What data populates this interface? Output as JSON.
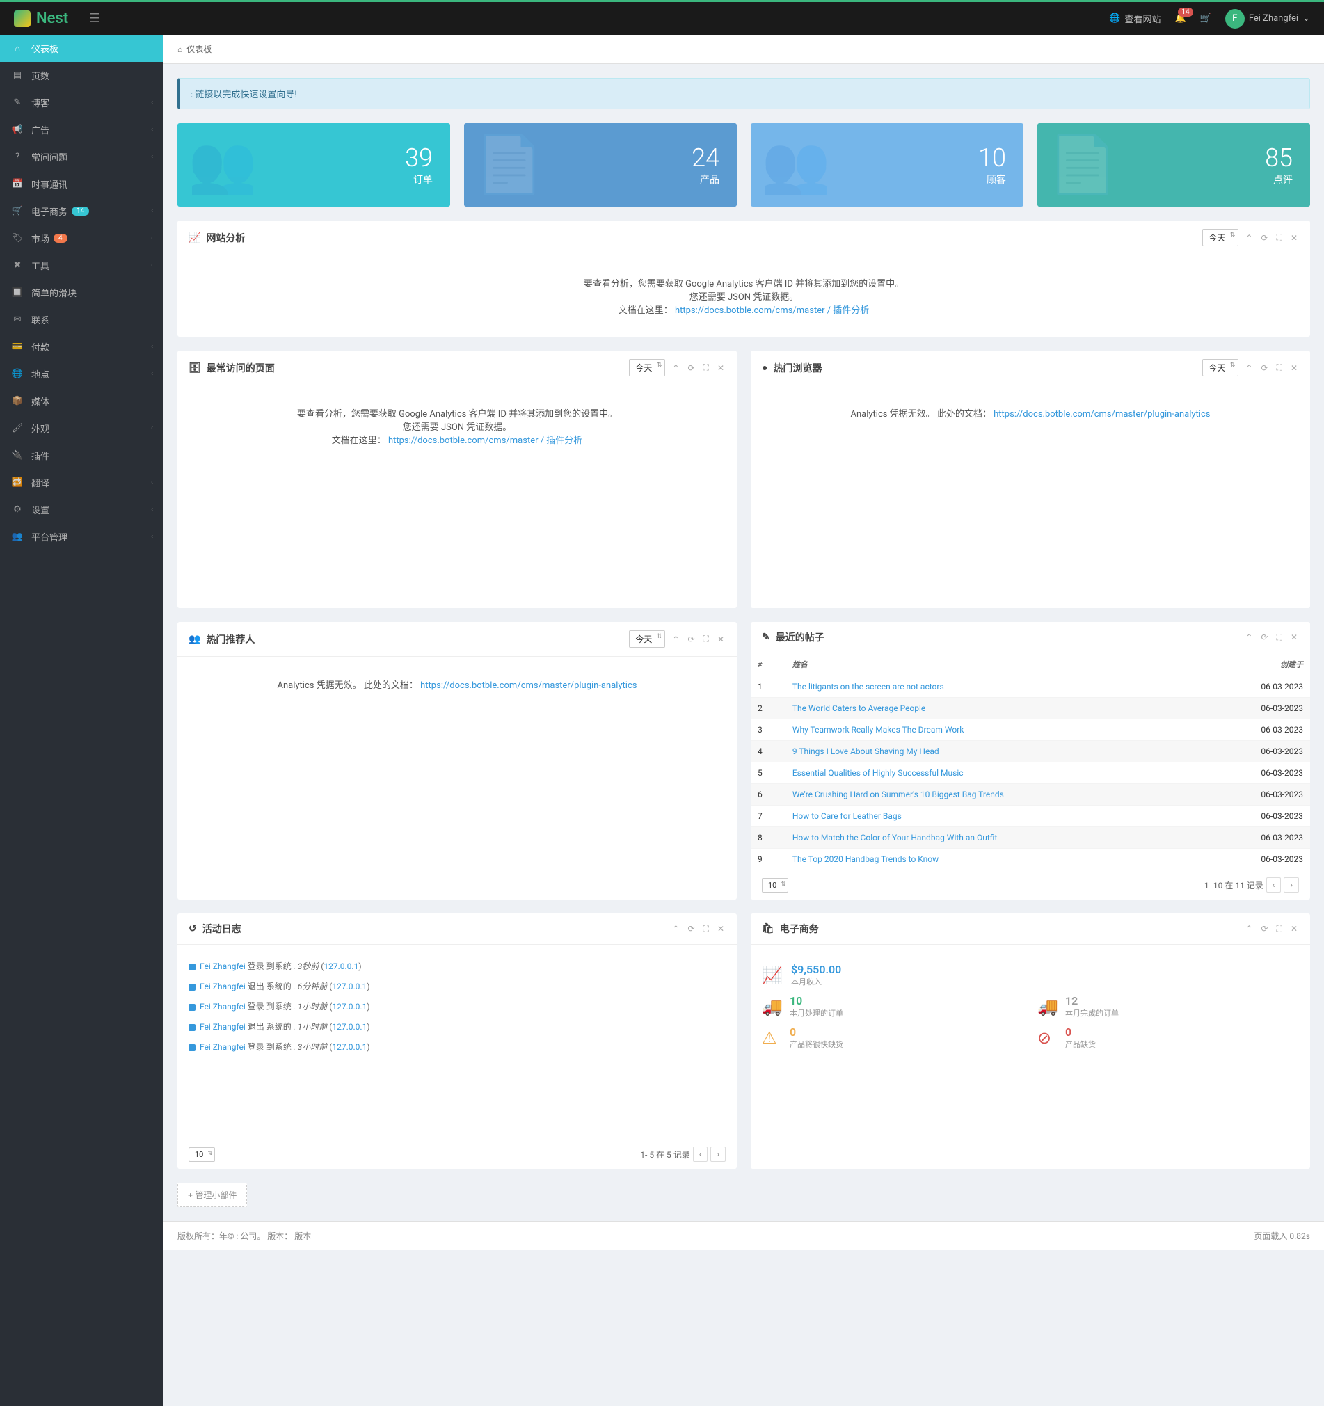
{
  "brand": "Nest",
  "navbar": {
    "view_site": "查看网站",
    "notif_count": "14",
    "user_initial": "F",
    "user_name": "Fei Zhangfei"
  },
  "sidebar": {
    "items": [
      {
        "icon": "⌂",
        "label": "仪表板",
        "active": true
      },
      {
        "icon": "▤",
        "label": "页数"
      },
      {
        "icon": "✎",
        "label": "博客",
        "chevron": true
      },
      {
        "icon": "📢",
        "label": "广告",
        "chevron": true
      },
      {
        "icon": "?",
        "label": "常问问题",
        "chevron": true
      },
      {
        "icon": "📅",
        "label": "时事通讯"
      },
      {
        "icon": "🛒",
        "label": "电子商务",
        "badge": "14",
        "chevron": true
      },
      {
        "icon": "🏷",
        "label": "市场",
        "badge": "4",
        "badge_class": "orange",
        "chevron": true
      },
      {
        "icon": "✖",
        "label": "工具",
        "chevron": true
      },
      {
        "icon": "🔲",
        "label": "简单的滑块"
      },
      {
        "icon": "✉",
        "label": "联系"
      },
      {
        "icon": "💳",
        "label": "付款",
        "chevron": true
      },
      {
        "icon": "🌐",
        "label": "地点",
        "chevron": true
      },
      {
        "icon": "📦",
        "label": "媒体"
      },
      {
        "icon": "🖌",
        "label": "外观",
        "chevron": true
      },
      {
        "icon": "🔌",
        "label": "插件"
      },
      {
        "icon": "🔁",
        "label": "翻译",
        "chevron": true
      },
      {
        "icon": "⚙",
        "label": "设置",
        "chevron": true
      },
      {
        "icon": "👥",
        "label": "平台管理",
        "chevron": true
      }
    ]
  },
  "breadcrumb": "仪表板",
  "alert_text": "链接以完成快速设置向导!",
  "tiles": [
    {
      "value": "39",
      "label": "订单",
      "icon": "👥"
    },
    {
      "value": "24",
      "label": "产品",
      "icon": "📄"
    },
    {
      "value": "10",
      "label": "顾客",
      "icon": "👥"
    },
    {
      "value": "85",
      "label": "点评",
      "icon": "📄"
    }
  ],
  "period_options": "今天",
  "panels": {
    "analytics": {
      "title": "网站分析",
      "msg1": "要查看分析，您需要获取 Google Analytics 客户端 ID 并将其添加到您的设置中。",
      "msg2": "您还需要 JSON 凭证数据。",
      "msg3_prefix": "文档在这里：",
      "msg3_link": "https://docs.botble.com/cms/master / 插件分析"
    },
    "top_pages": {
      "title": "最常访问的页面",
      "msg1": "要查看分析，您需要获取 Google Analytics 客户端 ID 并将其添加到您的设置中。",
      "msg2": "您还需要 JSON 凭证数据。",
      "msg3_prefix": "文档在这里：",
      "msg3_link": "https://docs.botble.com/cms/master / 插件分析"
    },
    "top_browsers": {
      "title": "热门浏览器",
      "msg_prefix": "Analytics 凭据无效。 此处的文档：",
      "msg_link": "https://docs.botble.com/cms/master/plugin-analytics"
    },
    "top_referrers": {
      "title": "热门推荐人",
      "msg_prefix": "Analytics 凭据无效。 此处的文档：",
      "msg_link": "https://docs.botble.com/cms/master/plugin-analytics"
    },
    "recent_posts": {
      "title": "最近的帖子",
      "cols": {
        "num": "#",
        "name": "姓名",
        "created": "创建于"
      },
      "rows": [
        {
          "n": "1",
          "title": "The litigants on the screen are not actors",
          "date": "06-03-2023"
        },
        {
          "n": "2",
          "title": "The World Caters to Average People",
          "date": "06-03-2023"
        },
        {
          "n": "3",
          "title": "Why Teamwork Really Makes The Dream Work",
          "date": "06-03-2023"
        },
        {
          "n": "4",
          "title": "9 Things I Love About Shaving My Head",
          "date": "06-03-2023"
        },
        {
          "n": "5",
          "title": "Essential Qualities of Highly Successful Music",
          "date": "06-03-2023"
        },
        {
          "n": "6",
          "title": "We're Crushing Hard on Summer's 10 Biggest Bag Trends",
          "date": "06-03-2023"
        },
        {
          "n": "7",
          "title": "How to Care for Leather Bags",
          "date": "06-03-2023"
        },
        {
          "n": "8",
          "title": "How to Match the Color of Your Handbag With an Outfit",
          "date": "06-03-2023"
        },
        {
          "n": "9",
          "title": "The Top 2020 Handbag Trends to Know",
          "date": "06-03-2023"
        }
      ],
      "page_size": "10",
      "pager_text": "1- 10 在 11 记录"
    },
    "activity": {
      "title": "活动日志",
      "items": [
        {
          "user": "Fei Zhangfei",
          "action": "登录  到系统",
          "time": ". 3秒前",
          "ip": "127.0.0.1"
        },
        {
          "user": "Fei Zhangfei",
          "action": "退出 系统的",
          "time": ". 6分钟前",
          "ip": "127.0.0.1"
        },
        {
          "user": "Fei Zhangfei",
          "action": "登录  到系统",
          "time": ". 1小时前",
          "ip": "127.0.0.1"
        },
        {
          "user": "Fei Zhangfei",
          "action": "退出 系统的",
          "time": ". 1小时前",
          "ip": "127.0.0.1"
        },
        {
          "user": "Fei Zhangfei",
          "action": "登录  到系统",
          "time": ". 3小时前",
          "ip": "127.0.0.1"
        }
      ],
      "page_size": "10",
      "pager_text": "1- 5 在 5 记录"
    },
    "ecommerce": {
      "title": "电子商务",
      "revenue": "$9,550.00",
      "revenue_label": "本月收入",
      "stats": [
        {
          "icon": "🚚",
          "color": "#3BB77E",
          "val": "10",
          "label": "本月处理的订单"
        },
        {
          "icon": "🚚",
          "color": "#999",
          "val": "12",
          "label": "本月完成的订单"
        },
        {
          "icon": "⚠",
          "color": "#f0ad4e",
          "val": "0",
          "label": "产品将很快缺货"
        },
        {
          "icon": "⊘",
          "color": "#d9534f",
          "val": "0",
          "label": "产品缺货"
        }
      ]
    }
  },
  "manage_widget": "管理小部件",
  "footer": {
    "left": "版权所有：年© : 公司。 版本： 版本",
    "right": "页面载入 0.82s"
  }
}
